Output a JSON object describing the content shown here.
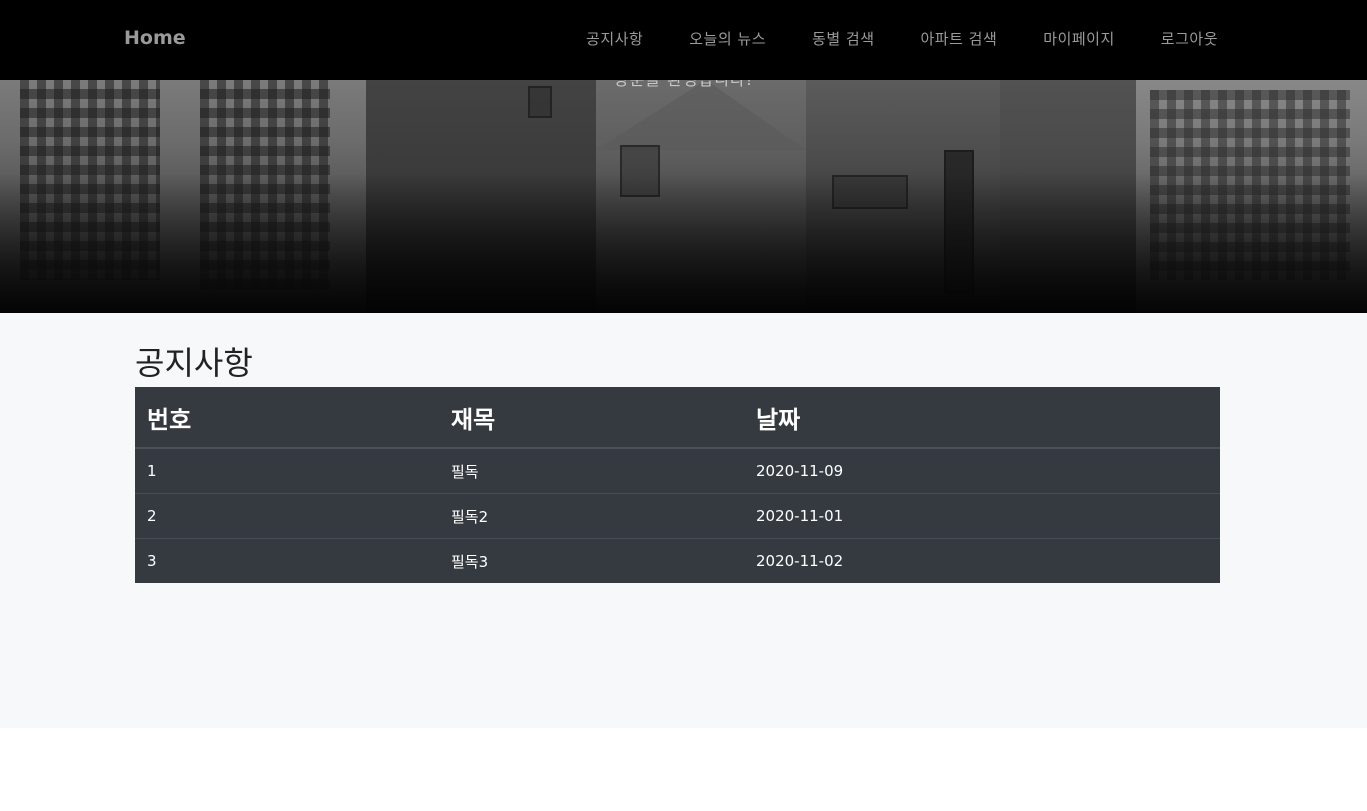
{
  "navbar": {
    "brand": "Home",
    "links": [
      "공지사항",
      "오늘의 뉴스",
      "동별 검색",
      "아파트 검색",
      "마이페이지",
      "로그아웃"
    ]
  },
  "hero": {
    "tagline": "방문을 환영합니다!"
  },
  "notice": {
    "title": "공지사항",
    "columns": [
      "번호",
      "재목",
      "날짜"
    ],
    "rows": [
      [
        "1",
        "필독",
        "2020-11-09"
      ],
      [
        "2",
        "필독2",
        "2020-11-01"
      ],
      [
        "3",
        "필독3",
        "2020-11-02"
      ]
    ]
  },
  "colors": {
    "navbar_bg": "#000000",
    "nav_text": "#9a9a9a",
    "table_bg": "#343a40",
    "content_bg": "#f7f8fa"
  }
}
